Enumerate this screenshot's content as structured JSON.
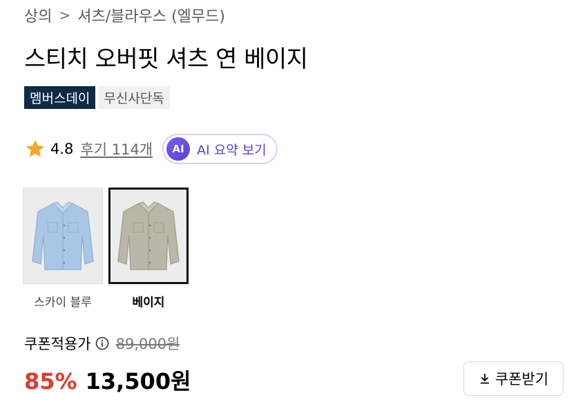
{
  "breadcrumb": {
    "category": "상의",
    "separator": ">",
    "subcategory": "셔츠/블라우스 (엘무드)"
  },
  "product": {
    "title": "스티치 오버핏 셔츠 연 베이지",
    "badges": [
      "멤버스데이",
      "무신사단독"
    ]
  },
  "rating": {
    "score": "4.8",
    "reviews_label": "후기 114개",
    "ai_icon_text": "AI",
    "ai_button_label": "AI 요약 보기"
  },
  "swatches": [
    {
      "label": "스카이 블루",
      "color": "#a9c6e6",
      "selected": false
    },
    {
      "label": "베이지",
      "color": "#b9b8a8",
      "selected": true
    }
  ],
  "pricing": {
    "coupon_label": "쿠폰적용가",
    "original_price": "89,000원",
    "discount": "85%",
    "final_price": "13,500원",
    "coupon_button_label": "쿠폰받기"
  },
  "colors": {
    "badge_dark": "#0f2a44",
    "discount_red": "#e03b2c",
    "ai_purple": "#5b3fd8",
    "star": "#f5a623"
  }
}
